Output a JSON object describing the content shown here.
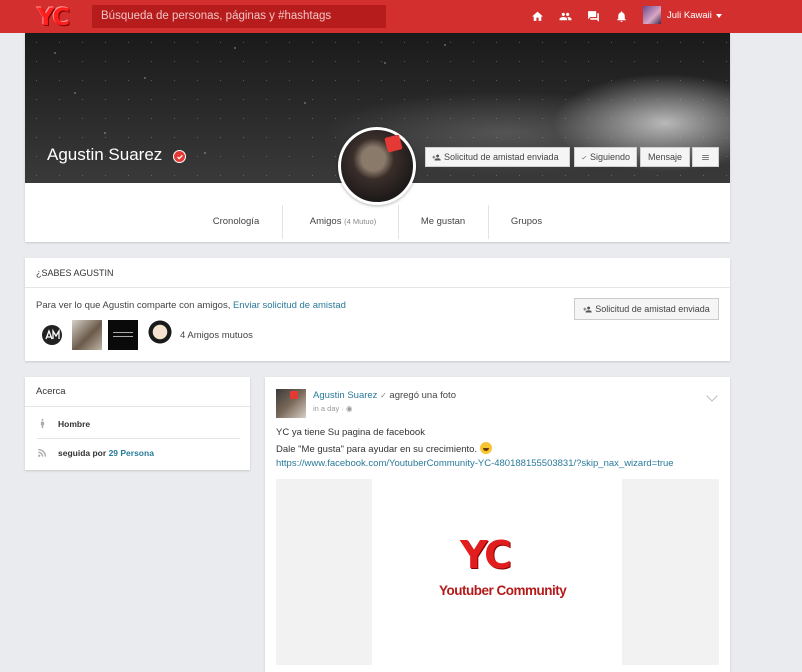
{
  "topbar": {
    "logo": "YC",
    "search_placeholder": "Búsqueda de personas, páginas y #hashtags",
    "icons": [
      "home-icon",
      "friends-icon",
      "messages-icon",
      "notifications-icon"
    ],
    "user_name": "Juli Kawaii",
    "color": "#d32f2f"
  },
  "profile": {
    "name": "Agustin Suarez",
    "buttons": {
      "friend_request": "Solicitud de amistad enviada",
      "following": "Siguiendo",
      "message": "Mensaje"
    },
    "tabs": [
      {
        "label": "Cronología",
        "extra": ""
      },
      {
        "label": "Amigos",
        "extra": "(4 Mutuo)"
      },
      {
        "label": "Me gustan",
        "extra": ""
      },
      {
        "label": "Grupos",
        "extra": ""
      }
    ]
  },
  "sabes": {
    "title": "¿SABES AGUSTIN",
    "text": "Para ver lo que Agustin comparte con amigos, ",
    "link": "Enviar solicitud de amistad",
    "button": "Solicitud de amistad enviada",
    "mutual_count": "4 Amigos mutuos"
  },
  "acerca": {
    "title": "Acerca",
    "gender": "Hombre",
    "followed_prefix": "seguida por",
    "followed_link": "29 Persona"
  },
  "post": {
    "author": "Agustin Suarez",
    "action": "agregó una foto",
    "time": "in a day ·",
    "line1": "YC ya tiene Su pagina de facebook",
    "line2": "Dale \"Me gusta\" para ayudar en su crecimiento.",
    "link": "https://www.facebook.com/YoutuberCommunity-YC-480188155503831/?skip_nax_wizard=true",
    "image_logo": "YC",
    "image_caption": "Youtuber Community"
  }
}
